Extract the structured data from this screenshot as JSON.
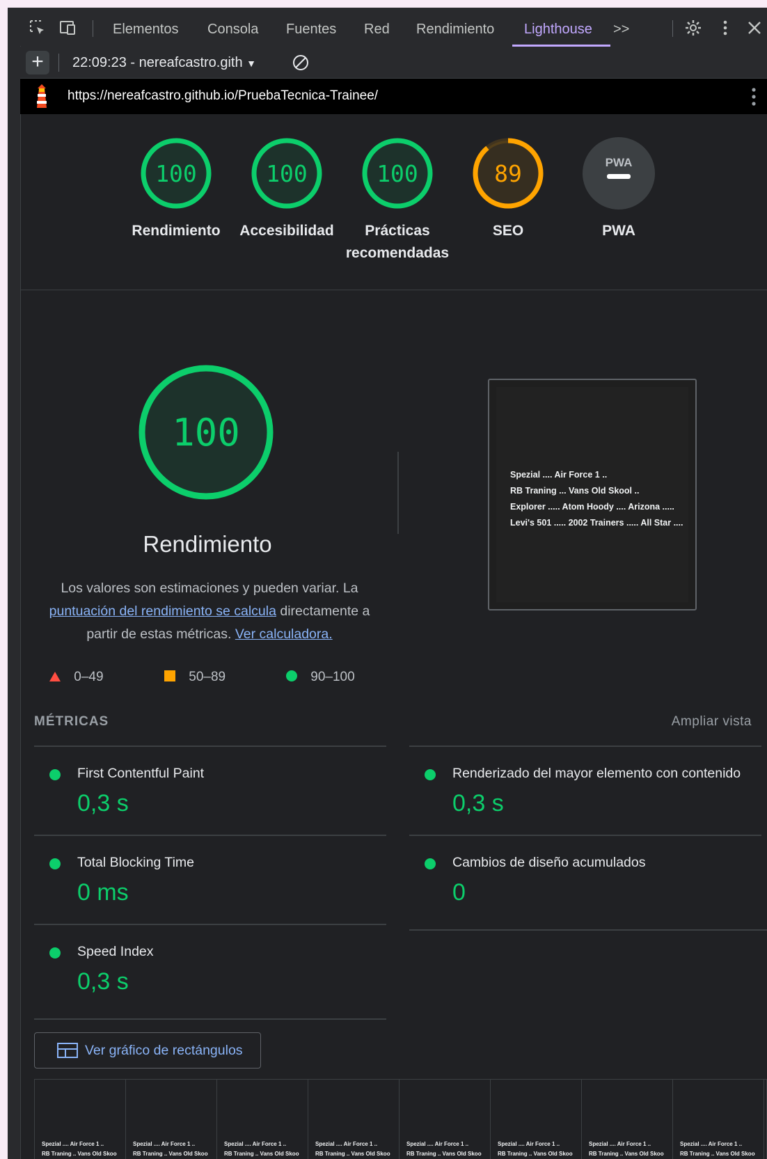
{
  "toolbar": {
    "tabs": [
      "Elementos",
      "Consola",
      "Fuentes",
      "Red",
      "Rendimiento",
      "Lighthouse"
    ],
    "more": ">>",
    "active_tab": "Lighthouse"
  },
  "session": {
    "plus": "+",
    "label": "22:09:23 - nereafcastro.gith"
  },
  "report": {
    "url": "https://nereafcastro.github.io/PruebaTecnica-Trainee/"
  },
  "gauges": [
    {
      "score": "100",
      "label": "Rendimiento",
      "fraction": 1.0,
      "color": "#0cce6b"
    },
    {
      "score": "100",
      "label": "Accesibilidad",
      "fraction": 1.0,
      "color": "#0cce6b"
    },
    {
      "score": "100",
      "label": "Prácticas recomendadas",
      "fraction": 1.0,
      "color": "#0cce6b"
    },
    {
      "score": "89",
      "label": "SEO",
      "fraction": 0.89,
      "color": "#ffa400"
    },
    {
      "score": "PWA",
      "label": "PWA",
      "fraction": 0,
      "color": "#9aa0a6"
    }
  ],
  "performance": {
    "score": "100",
    "title": "Rendimiento",
    "desc_pre": "Los valores son estimaciones y pueden variar. La ",
    "desc_link1": "puntuación del rendimiento se calcula",
    "desc_mid": " directamente a partir de estas métricas. ",
    "desc_link2": "Ver calculadora."
  },
  "legend": [
    {
      "range": "0–49",
      "color": "#ff4e42"
    },
    {
      "range": "50–89",
      "color": "#ffa400"
    },
    {
      "range": "90–100",
      "color": "#0cce6b"
    }
  ],
  "screenshot_lines": [
    "Spezial ....  Air Force 1 ..",
    "RB Traning ...  Vans Old Skool ..",
    "Explorer .....  Atom Hoody ....  Arizona .....",
    "Levi's 501 .....  2002 Trainers .....  All Star ...."
  ],
  "metrics": {
    "title": "MÉTRICAS",
    "toggle": "Ampliar vista",
    "items": [
      {
        "label": "First Contentful Paint",
        "value": "0,3 s"
      },
      {
        "label": "Renderizado del mayor elemento con contenido",
        "value": "0,3 s"
      },
      {
        "label": "Total Blocking Time",
        "value": "0 ms"
      },
      {
        "label": "Cambios de diseño acumulados",
        "value": "0"
      },
      {
        "label": "Speed Index",
        "value": "0,3 s"
      }
    ]
  },
  "treemap_button": "Ver gráfico de rectángulos",
  "filmstrip_lines": [
    "Spezial ....  Air Force 1 ..",
    "RB Traning ..  Vans Old Skoo"
  ],
  "filmstrip_count": 8
}
